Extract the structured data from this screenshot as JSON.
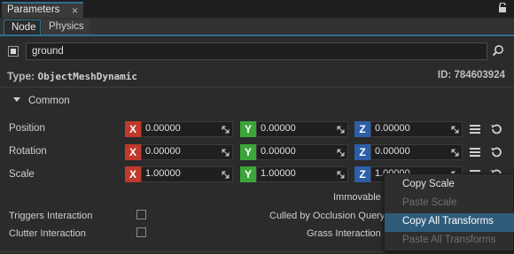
{
  "window": {
    "title": "Parameters",
    "close_glyph": "×"
  },
  "tabs": [
    {
      "label": "Node"
    },
    {
      "label": "Physics"
    }
  ],
  "node": {
    "name": "ground",
    "type_label": "Type:",
    "type_value": "ObjectMeshDynamic",
    "id_label": "ID:",
    "id_value": "784603924"
  },
  "section": {
    "title": "Common"
  },
  "transforms": [
    {
      "label": "Position",
      "x": "0.00000",
      "y": "0.00000",
      "z": "0.00000"
    },
    {
      "label": "Rotation",
      "x": "0.00000",
      "y": "0.00000",
      "z": "0.00000"
    },
    {
      "label": "Scale",
      "x": "1.00000",
      "y": "1.00000",
      "z": "1.00000"
    }
  ],
  "axes": {
    "x": "X",
    "y": "Y",
    "z": "Z"
  },
  "properties": {
    "immovable": "Immovable",
    "triggers_interaction": "Triggers Interaction",
    "culled_by_occlusion_query": "Culled by Occlusion Query",
    "clutter_interaction": "Clutter Interaction",
    "grass_interaction": "Grass Interaction"
  },
  "context_menu": [
    {
      "label": "Copy Scale",
      "enabled": true
    },
    {
      "label": "Paste Scale",
      "enabled": false
    },
    {
      "label": "Copy All Transforms",
      "enabled": true,
      "highlighted": true
    },
    {
      "label": "Paste All Transforms",
      "enabled": false
    }
  ],
  "colors": {
    "accent": "#2f6f93",
    "x_axis": "#c0392b",
    "y_axis": "#3aa63a",
    "z_axis": "#2d5fa8",
    "menu_highlight": "#2f5c7a"
  },
  "icons": [
    "lock-icon",
    "search-icon",
    "menu-icon",
    "reset-icon",
    "expand-grip-icon",
    "collapse-arrow-icon"
  ]
}
